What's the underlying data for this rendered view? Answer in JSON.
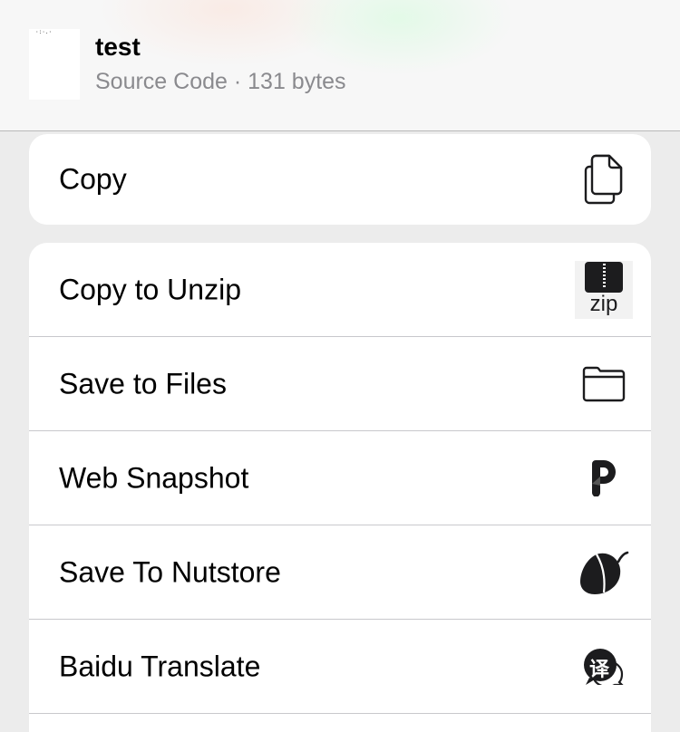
{
  "header": {
    "file_name": "test",
    "file_subtitle": "Source Code · 131 bytes",
    "thumb_glyph": "·:·.·"
  },
  "actions_primary": [
    {
      "label": "Copy",
      "icon": "copy-icon"
    }
  ],
  "actions_list": [
    {
      "label": "Copy to Unzip",
      "icon": "zip-app-icon",
      "icon_text": "zip"
    },
    {
      "label": "Save to Files",
      "icon": "folder-icon"
    },
    {
      "label": "Web Snapshot",
      "icon": "web-snapshot-p-icon"
    },
    {
      "label": "Save To Nutstore",
      "icon": "nutstore-acorn-icon"
    },
    {
      "label": "Baidu Translate",
      "icon": "baidu-translate-icon",
      "icon_text": "译"
    }
  ],
  "colors": {
    "background": "#ececec",
    "card": "#ffffff",
    "separator": "#c8c8cc",
    "subtitle": "#8a8a8e"
  }
}
